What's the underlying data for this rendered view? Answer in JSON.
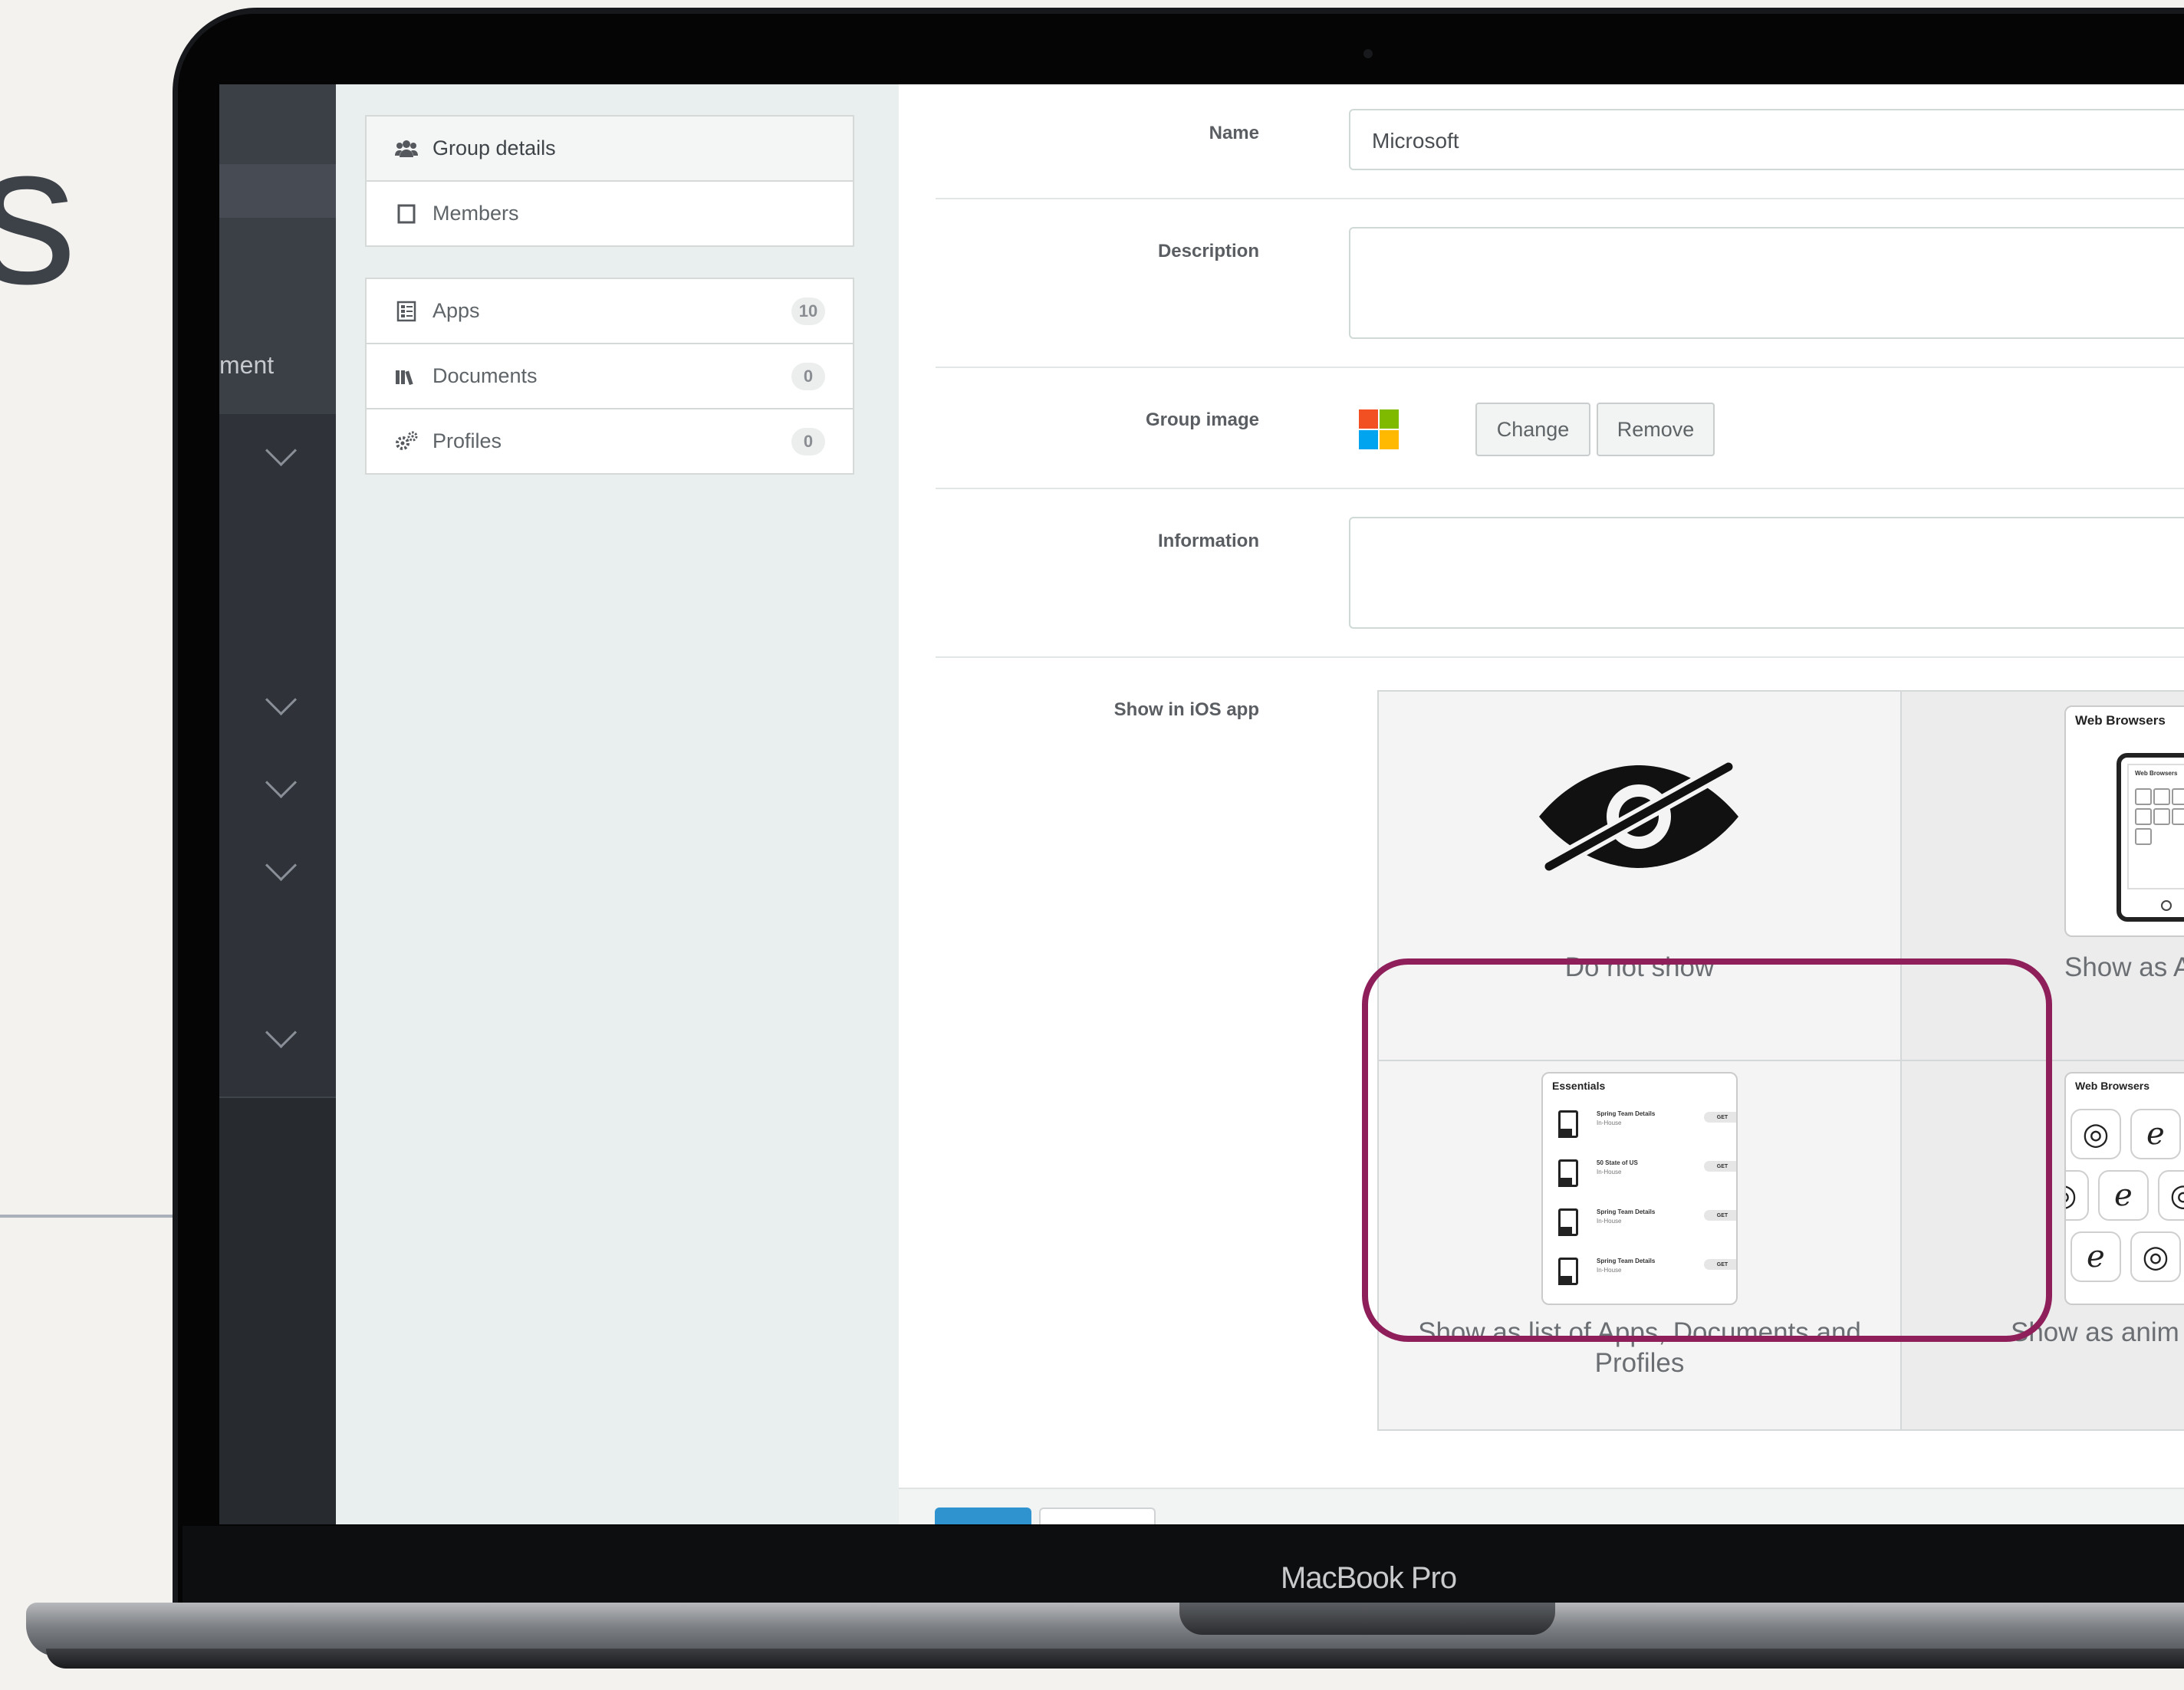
{
  "background": {
    "heading_fragment": "s",
    "device_label": "MacBook Pro"
  },
  "nav": {
    "partial_label": "ment"
  },
  "sidebar": {
    "group_menu": [
      {
        "label": "Group details",
        "icon": "users-icon"
      },
      {
        "label": "Members",
        "icon": "square-icon"
      }
    ],
    "content_menu": [
      {
        "label": "Apps",
        "count": "10",
        "icon": "apps-icon"
      },
      {
        "label": "Documents",
        "count": "0",
        "icon": "library-icon"
      },
      {
        "label": "Profiles",
        "count": "0",
        "icon": "gears-icon"
      }
    ]
  },
  "form": {
    "name_label": "Name",
    "name_value": "Microsoft",
    "description_label": "Description",
    "description_value": "",
    "group_image_label": "Group image",
    "change_button": "Change",
    "remove_button": "Remove",
    "information_label": "Information",
    "information_value": "",
    "show_in_ios_label": "Show in iOS app",
    "options": {
      "do_not_show": "Do not show",
      "show_as_partial": "Show as A",
      "show_as_list": "Show as list of Apps, Documents and Profiles",
      "show_as_anim_partial": "Show as anim"
    },
    "thumb_titles": {
      "web_browsers": "Web Browsers",
      "web_browsers_small": "Web Browsers",
      "essentials": "Essentials",
      "web_browsers_grid": "Web Browsers"
    },
    "documents": [
      {
        "title": "Spring Team Details",
        "subtitle": "In-House",
        "action": "GET"
      },
      {
        "title": "50 State of US",
        "subtitle": "In-House",
        "action": "GET"
      },
      {
        "title": "Spring Team Details",
        "subtitle": "In-House",
        "action": "GET"
      },
      {
        "title": "Spring Team Details",
        "subtitle": "In-House",
        "action": "GET"
      }
    ]
  },
  "colors": {
    "selection_frame": "#8e1f5a",
    "primary_button": "#2f93d0",
    "logo_red": "#f25022",
    "logo_green": "#7fba00",
    "logo_blue": "#00a4ef",
    "logo_yellow": "#ffb900"
  }
}
